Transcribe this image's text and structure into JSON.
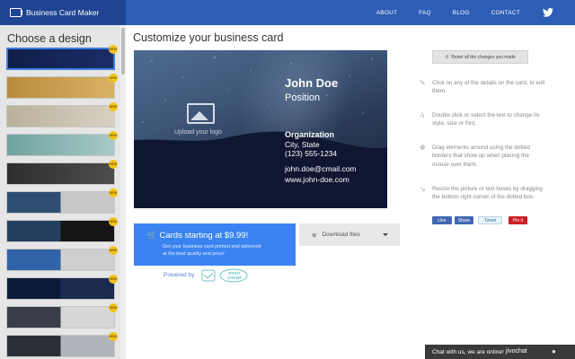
{
  "navbar": {
    "brand": "Business Card Maker",
    "links": [
      "ABOUT",
      "FAQ",
      "BLOG",
      "CONTACT"
    ],
    "social_icon": "twitter-icon",
    "color": "#2d5db5"
  },
  "sidebar": {
    "title": "Choose a design",
    "badge": "NEW",
    "designs": [
      {
        "name": "night-sky",
        "colors": [
          "#0f1f4a",
          "#1a2d66"
        ],
        "selected": true
      },
      {
        "name": "gold",
        "colors": [
          "#b88c3e",
          "#d8b263"
        ]
      },
      {
        "name": "beige",
        "colors": [
          "#b9b09c",
          "#d8d1c2"
        ]
      },
      {
        "name": "teal",
        "colors": [
          "#6fa2a0",
          "#a8cac7"
        ]
      },
      {
        "name": "charcoal",
        "colors": [
          "#2e2e2e",
          "#4c4c4c"
        ]
      },
      {
        "name": "milky-way-silver",
        "colors": [
          "#2e4f73",
          "#c8c8c8"
        ]
      },
      {
        "name": "milky-way-dark",
        "colors": [
          "#243e5e",
          "#151515"
        ]
      },
      {
        "name": "stars-silver",
        "colors": [
          "#3163a8",
          "#cfcfcf"
        ]
      },
      {
        "name": "night-hills",
        "colors": [
          "#0d1a3a",
          "#1b2a4e"
        ]
      },
      {
        "name": "city-silver",
        "colors": [
          "#3a3e48",
          "#d6d6d6"
        ]
      },
      {
        "name": "city-gold",
        "colors": [
          "#2c3036",
          "#b0b4bb"
        ]
      }
    ]
  },
  "main": {
    "title": "Customize your business card",
    "card": {
      "image_label": "Upload your logo",
      "name": "John Doe",
      "position": "Position",
      "organization": "Organization",
      "city": "City, State",
      "phone": "(123) 555-1234",
      "email": "john.doe@cmail.com",
      "website": "www.john-doe.com"
    },
    "cta": {
      "title": "Cards starting at $9.99!",
      "line1": "Get your business card printed and delivered",
      "line2": "at the best quality and price!",
      "color": "#3a83f0"
    },
    "download_label": "Download files",
    "powered_by": "Powered by",
    "powered_logo": "PRINT CHOMP"
  },
  "right": {
    "reset_label": "Reset all the changes you made",
    "tips": [
      {
        "icon": "pencil-icon",
        "lines": [
          "Click on any of the details on the card, to edit",
          "them."
        ]
      },
      {
        "icon": "font-icon",
        "lines": [
          "Double click or select the text to change its",
          "style, size or font."
        ]
      },
      {
        "icon": "move-icon",
        "lines": [
          "Drag elements around using the dotted",
          "borders that show up when placing the",
          "mouse over them."
        ]
      },
      {
        "icon": "resize-icon",
        "lines": [
          "Resize the picture or text boxes by dragging",
          "the bottom right corner of the dotted box."
        ]
      }
    ],
    "social": [
      {
        "label": "Like",
        "color": "#4267b2"
      },
      {
        "label": "Share",
        "color": "#4267b2"
      },
      {
        "label": "Tweet",
        "color": "#5aa1e3"
      },
      {
        "label": "Pin it",
        "color": "#cb2027"
      }
    ]
  },
  "chat": {
    "text": "Chat with us, we are online!",
    "brand": "jivochat"
  }
}
